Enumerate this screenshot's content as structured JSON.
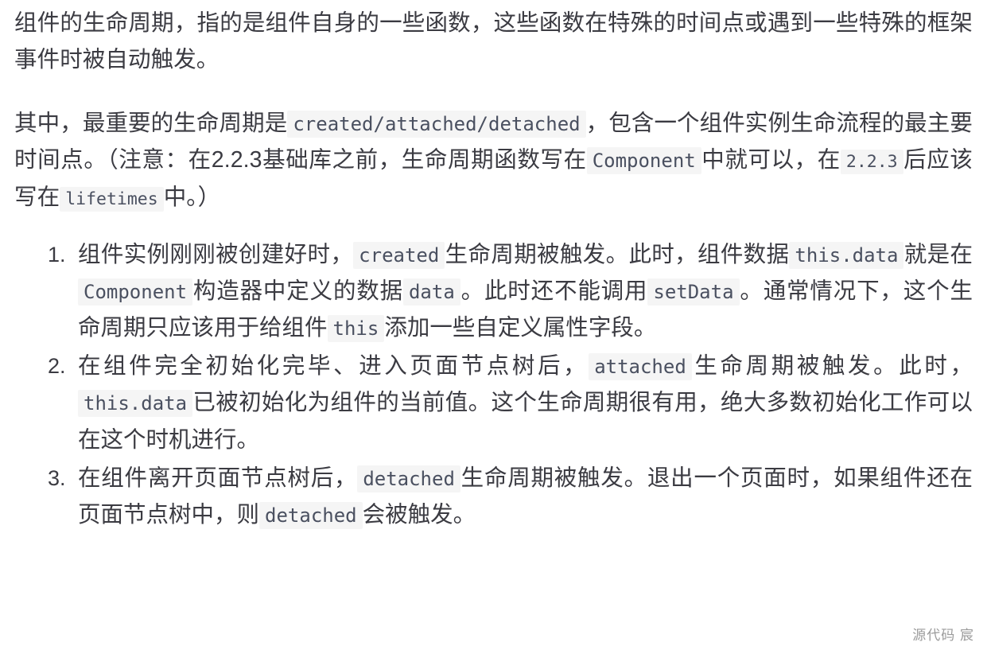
{
  "document": {
    "paragraphs": [
      {
        "id": "intro",
        "segments": [
          {
            "type": "text",
            "value": "组件的生命周期，指的是组件自身的一些函数，这些函数在特殊的时间点或遇到一些特殊的框架事件时被自动触发。"
          }
        ]
      },
      {
        "id": "most-important",
        "segments": [
          {
            "type": "text",
            "value": "其中，最重要的生命周期是"
          },
          {
            "type": "code",
            "value": "created/attached/detached"
          },
          {
            "type": "text",
            "value": "，包含一个组件实例生命流程的最主要时间点。（注意：在2.2.3基础库之前，生命周期函数写在"
          },
          {
            "type": "code",
            "value": "Component"
          },
          {
            "type": "text",
            "value": "中就可以，在"
          },
          {
            "type": "code",
            "value": "2.2.3",
            "small": true
          },
          {
            "type": "text",
            "value": "后应该写在"
          },
          {
            "type": "code",
            "value": "lifetimes",
            "small": true
          },
          {
            "type": "text",
            "value": "中。）"
          }
        ]
      }
    ],
    "list": {
      "start": 1,
      "items": [
        {
          "index": "1",
          "segments": [
            {
              "type": "text",
              "value": "组件实例刚刚被创建好时，"
            },
            {
              "type": "code",
              "value": "created"
            },
            {
              "type": "text",
              "value": "生命周期被触发。此时，组件数据"
            },
            {
              "type": "code",
              "value": "this.data"
            },
            {
              "type": "text",
              "value": "就是在"
            },
            {
              "type": "code",
              "value": "Component"
            },
            {
              "type": "text",
              "value": "构造器中定义的数据"
            },
            {
              "type": "code",
              "value": "data"
            },
            {
              "type": "text",
              "value": "。此时还不能调用"
            },
            {
              "type": "code",
              "value": "setData"
            },
            {
              "type": "text",
              "value": "。通常情况下，这个生命周期只应该用于给组件"
            },
            {
              "type": "code",
              "value": "this"
            },
            {
              "type": "text",
              "value": "添加一些自定义属性字段。"
            }
          ]
        },
        {
          "index": "2",
          "segments": [
            {
              "type": "text",
              "value": "在组件完全初始化完毕、进入页面节点树后，"
            },
            {
              "type": "code",
              "value": "attached"
            },
            {
              "type": "text",
              "value": "生命周期被触发。此时，"
            },
            {
              "type": "code",
              "value": "this.data"
            },
            {
              "type": "text",
              "value": "已被初始化为组件的当前值。这个生命周期很有用，绝大多数初始化工作可以在这个时机进行。"
            }
          ]
        },
        {
          "index": "3",
          "segments": [
            {
              "type": "text",
              "value": "在组件离开页面节点树后，"
            },
            {
              "type": "code",
              "value": "detached"
            },
            {
              "type": "text",
              "value": "生命周期被触发。退出一个页面时，如果组件还在页面节点树中，则"
            },
            {
              "type": "code",
              "value": "detached"
            },
            {
              "type": "text",
              "value": "会被触发。"
            }
          ]
        }
      ]
    },
    "watermark": "源代码  宸",
    "colors": {
      "text": "#3b3b42",
      "code_text": "#4a5060",
      "code_background": "#f5f5f5",
      "page_background": "#ffffff",
      "watermark": "#9b9b9b"
    }
  }
}
